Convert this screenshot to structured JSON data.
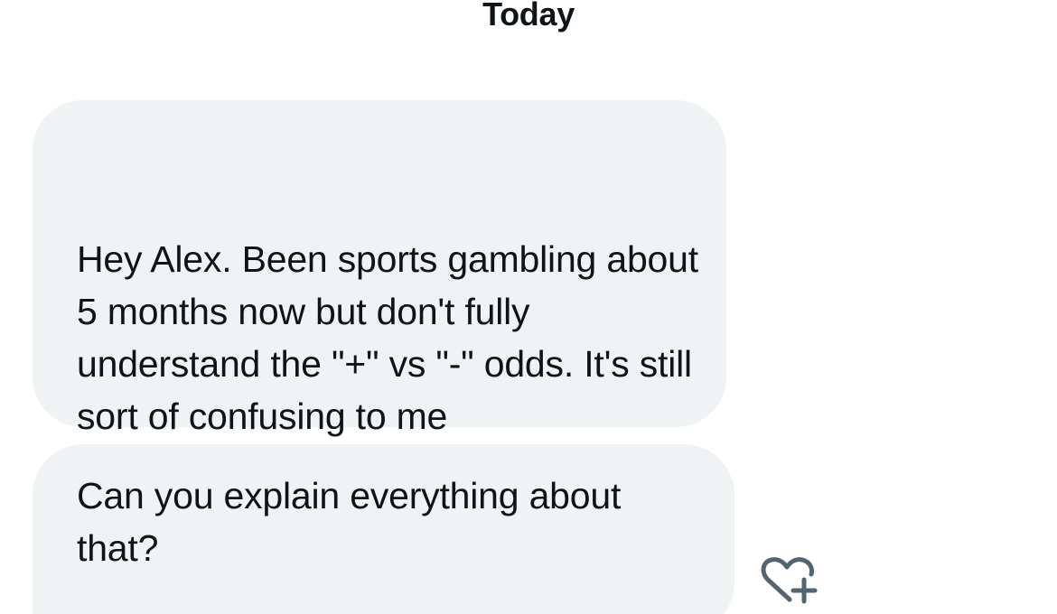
{
  "conversation": {
    "date_separator": "Today",
    "messages": [
      {
        "text": "Hey Alex. Been sports gambling about 5 months now but don't fully understand the \"+\" vs \"-\" odds. It's still sort of confusing to me"
      },
      {
        "text": "Can you explain everything about that?"
      }
    ],
    "reaction_icon": "heart-plus-icon"
  },
  "colors": {
    "bubble_background": "#eff3f4",
    "text": "#0f1419",
    "icon": "#536471"
  }
}
